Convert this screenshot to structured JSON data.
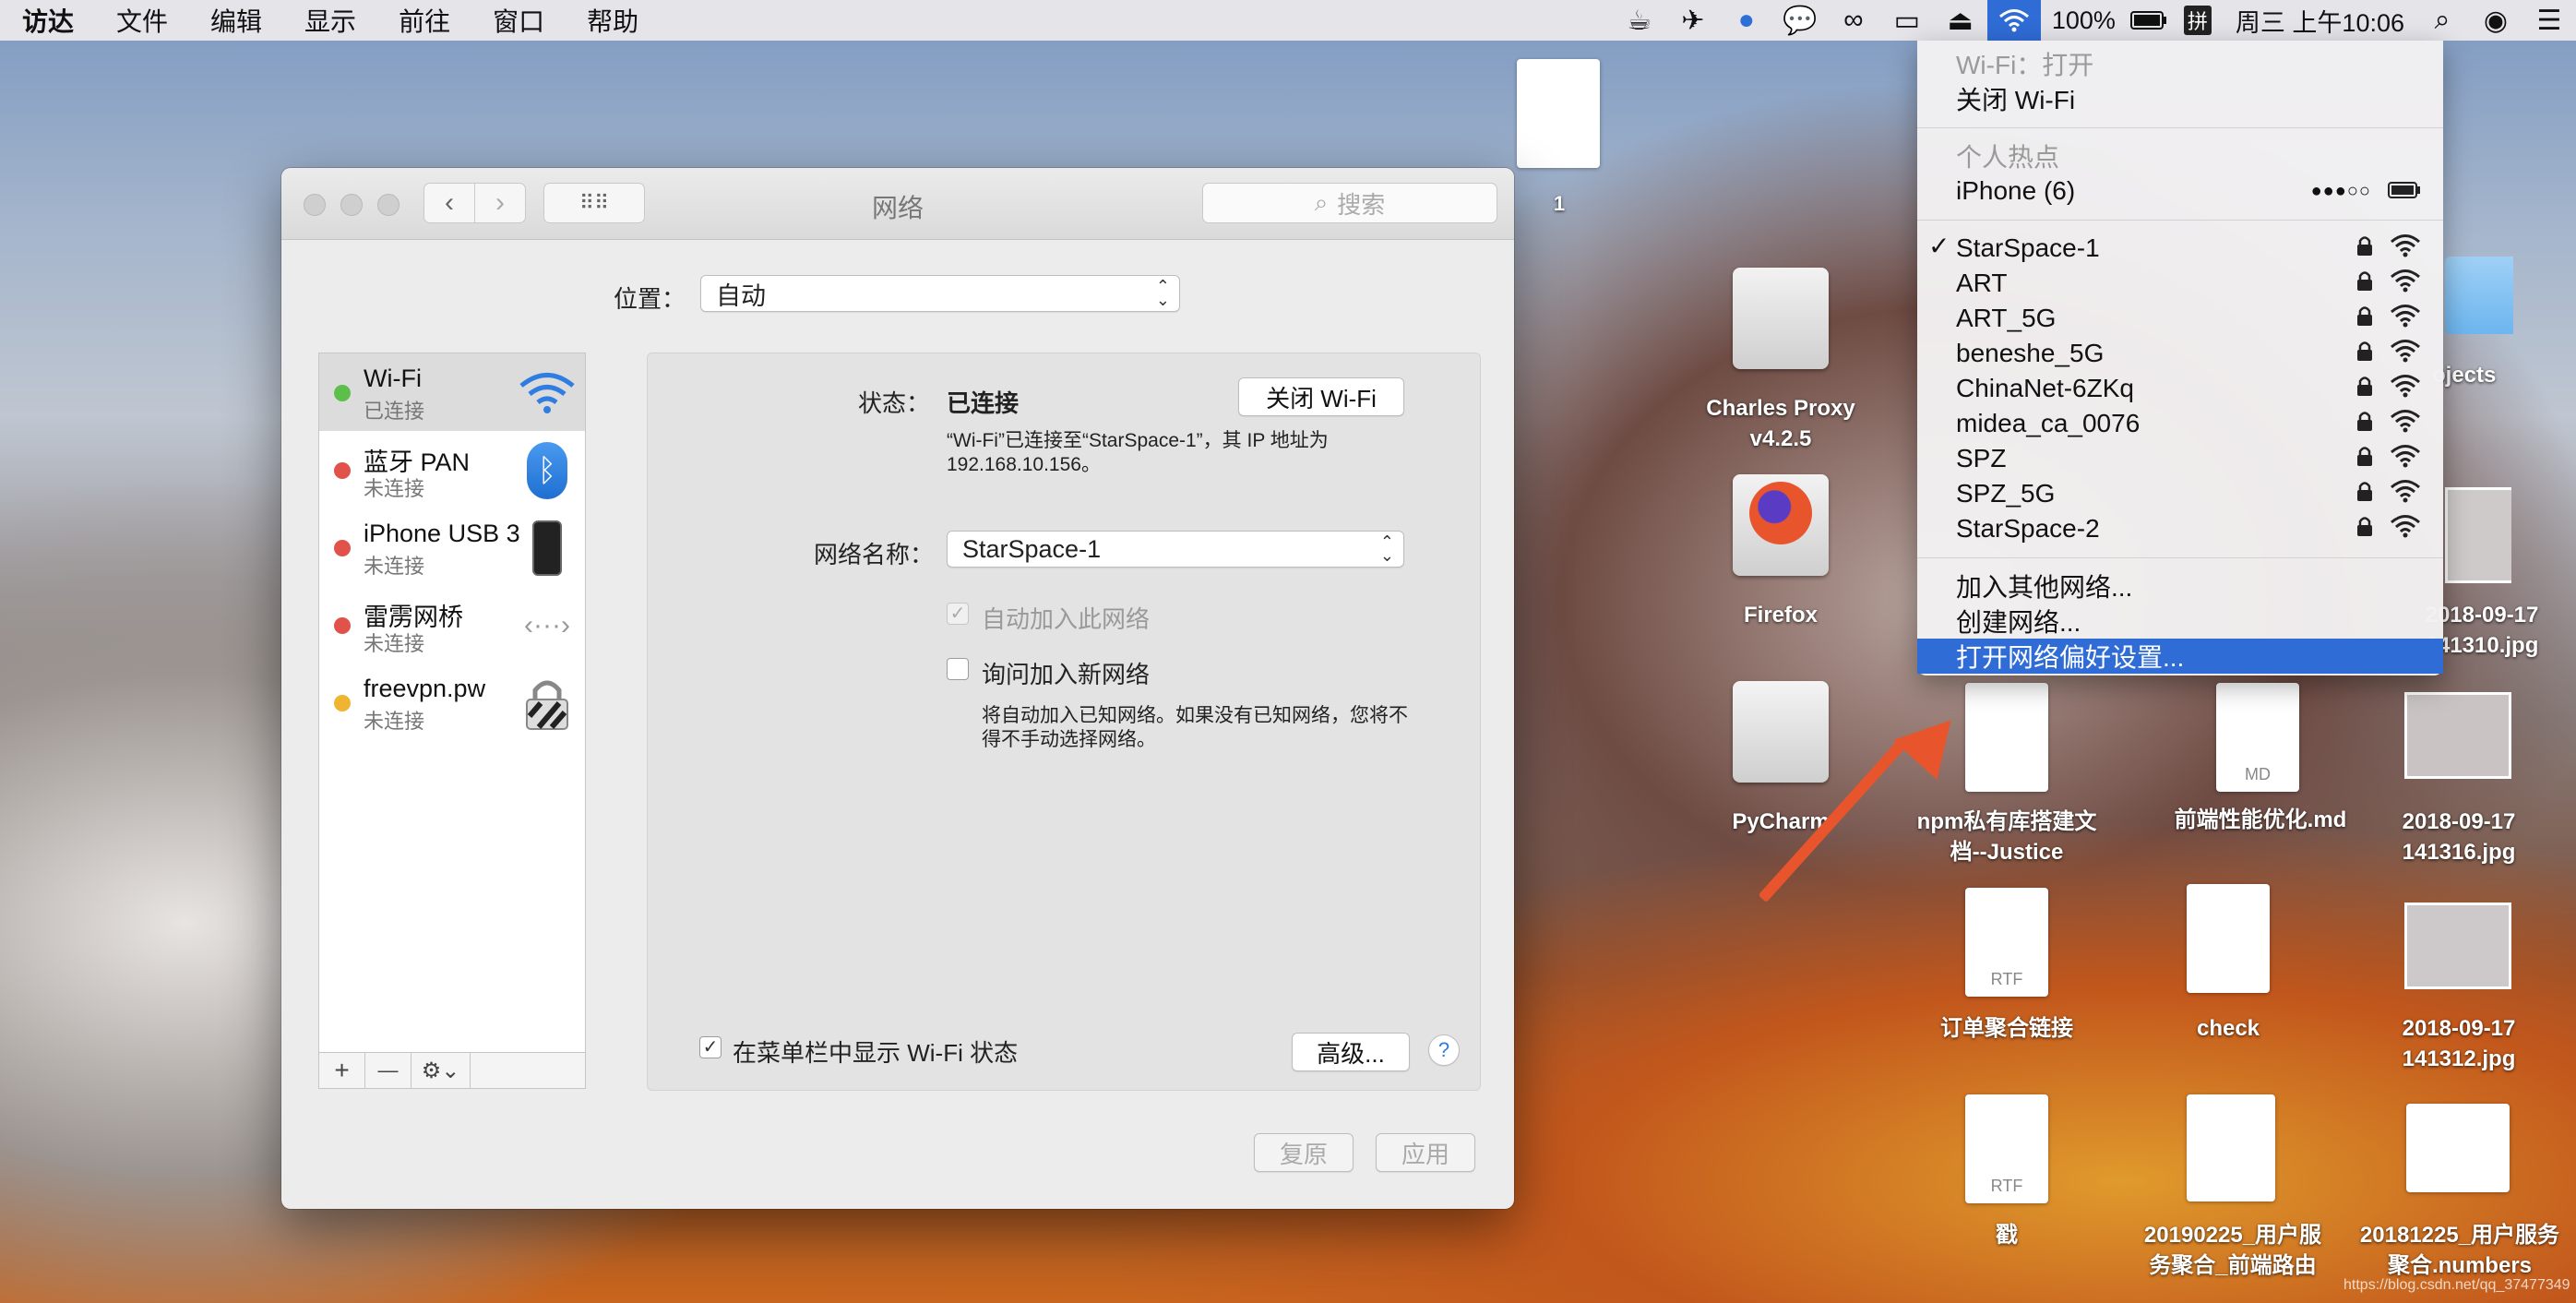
{
  "menubar": {
    "items": [
      "访达",
      "文件",
      "编辑",
      "显示",
      "前往",
      "窗口",
      "帮助"
    ],
    "battery": "100%",
    "ime": "拼",
    "clock": "周三 上午10:06"
  },
  "window": {
    "title": "网络",
    "search_placeholder": "搜索",
    "location_label": "位置：",
    "location_value": "自动",
    "services": [
      {
        "name": "Wi-Fi",
        "status": "已连接",
        "dot": "#5cbf4a",
        "icon": "wifi-icon"
      },
      {
        "name": "蓝牙 PAN",
        "status": "未连接",
        "dot": "#e0524a",
        "icon": "bluetooth-icon"
      },
      {
        "name": "iPhone USB 3",
        "status": "未连接",
        "dot": "#e0524a",
        "icon": "iphone-icon"
      },
      {
        "name": "雷雳网桥",
        "status": "未连接",
        "dot": "#e0524a",
        "icon": "thunderbolt-bridge-icon"
      },
      {
        "name": "freevpn.pw",
        "status": "未连接",
        "dot": "#efb530",
        "icon": "vpn-lock-icon"
      }
    ],
    "sidebar_buttons": {
      "add": "+",
      "remove": "—",
      "gear": "⚙⌄"
    },
    "status_label": "状态：",
    "status_value": "已连接",
    "turn_off_button": "关闭 Wi-Fi",
    "status_desc_line1": "“Wi-Fi”已连接至“StarSpace-1”，其 IP 地址为",
    "status_desc_line2": "192.168.10.156。",
    "network_name_label": "网络名称：",
    "network_name_value": "StarSpace-1",
    "auto_join_label": "自动加入此网络",
    "auto_join_checked": true,
    "ask_join_label": "询问加入新网络",
    "ask_join_checked": false,
    "ask_desc_line1": "将自动加入已知网络。如果没有已知网络，您将不",
    "ask_desc_line2": "得不手动选择网络。",
    "show_in_menubar_label": "在菜单栏中显示 Wi-Fi 状态",
    "show_in_menubar_checked": true,
    "advanced_button": "高级...",
    "help_button": "?",
    "revert_button": "复原",
    "apply_button": "应用"
  },
  "wifi_menu": {
    "wifi_status": "Wi-Fi：打开",
    "turn_off": "关闭 Wi-Fi",
    "hotspot_header": "个人热点",
    "hotspot_device": "iPhone (6)",
    "hotspot_signal": "●●●○○",
    "networks": [
      {
        "name": "StarSpace-1",
        "selected": true
      },
      {
        "name": "ART",
        "selected": false
      },
      {
        "name": "ART_5G",
        "selected": false
      },
      {
        "name": "beneshe_5G",
        "selected": false
      },
      {
        "name": "ChinaNet-6ZKq",
        "selected": false
      },
      {
        "name": "midea_ca_0076",
        "selected": false
      },
      {
        "name": "SPZ",
        "selected": false
      },
      {
        "name": "SPZ_5G",
        "selected": false
      },
      {
        "name": "StarSpace-2",
        "selected": false
      }
    ],
    "join_other": "加入其他网络...",
    "create_network": "创建网络...",
    "open_prefs": "打开网络偏好设置..."
  },
  "desktop": {
    "icons": [
      {
        "label": "1"
      },
      {
        "label": "Charles Proxy",
        "label2": "v4.2.5"
      },
      {
        "label": "Firefox"
      },
      {
        "label": "PyCharm"
      },
      {
        "label": "npm私有库搭建文",
        "label2": "档--Justice"
      },
      {
        "label": "前端性能优化.md",
        "badge": "MD"
      },
      {
        "label": "2018-09-17",
        "label2": "141316.jpg"
      },
      {
        "label": "订单聚合链接",
        "badge": "RTF"
      },
      {
        "label": "check"
      },
      {
        "label": "2018-09-17",
        "label2": "141312.jpg"
      },
      {
        "label": "戳",
        "badge": "RTF"
      },
      {
        "label": "20190225_用户服",
        "label2": "务聚合_前端路由"
      },
      {
        "label": "20181225_用户服务",
        "label2": "聚合.numbers"
      },
      {
        "label": "2018-09-17",
        "label2": "141310.jpg"
      },
      {
        "label": "ojects"
      }
    ],
    "watermark": "https://blog.csdn.net/qq_37477349",
    "arrow_color": "#e8552d"
  }
}
